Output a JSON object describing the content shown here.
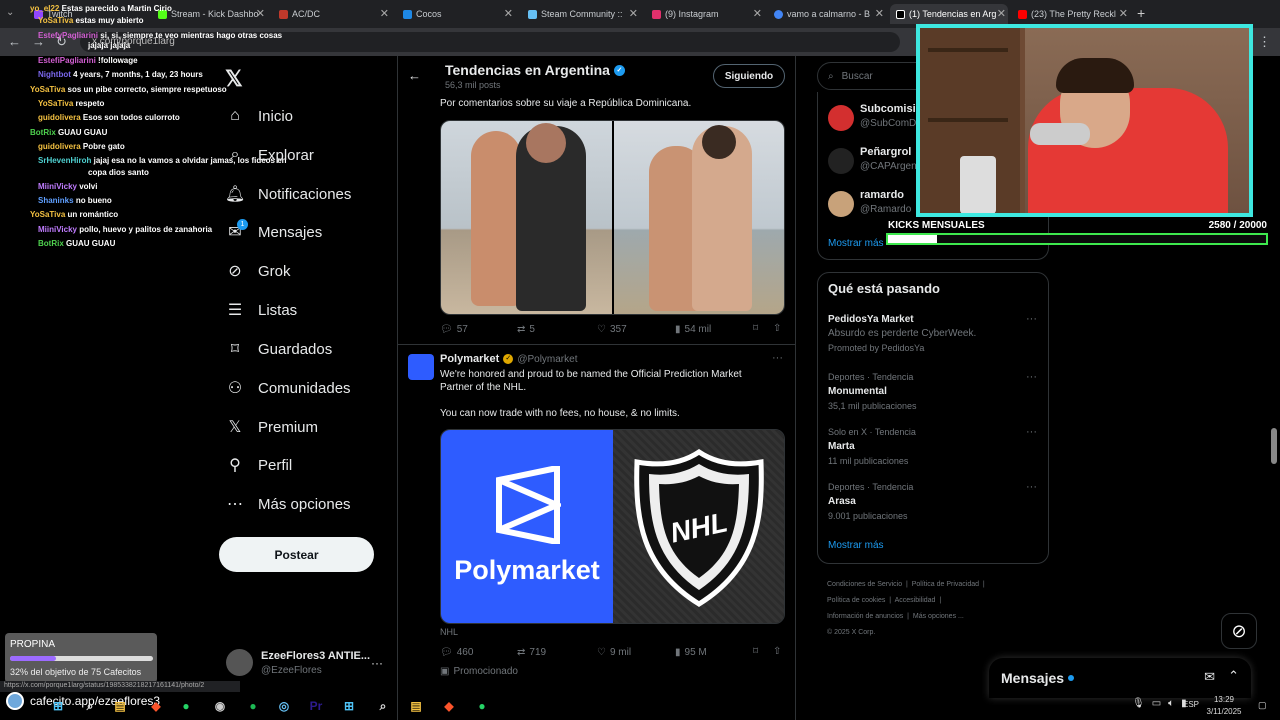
{
  "browser": {
    "tabs": [
      {
        "label": "Twitch",
        "color": "#9146ff"
      },
      {
        "label": "Stream - Kick Dashbo",
        "color": "#53fc18"
      },
      {
        "label": "AC/DC",
        "color": "#c0392b"
      },
      {
        "label": "Cocos",
        "color": "#1e88e5"
      },
      {
        "label": "Steam Community ::",
        "color": "#1b2838"
      },
      {
        "label": "(9) Instagram",
        "color": "#e1306c"
      },
      {
        "label": "vamo a calmarno - B",
        "color": "#4285f4"
      },
      {
        "label": "(1) Tendencias en Arg",
        "color": "#000000"
      },
      {
        "label": "(23) The Pretty Reckl",
        "color": "#ff0000"
      }
    ],
    "url": "x.com/porque1larg",
    "status_url": "https://x.com/porque1larg/status/1985338218217161141/photo/2"
  },
  "chat": [
    {
      "user": "yo_el22",
      "msg": "Estas parecido a Martin Cirio",
      "color": "#f5c242"
    },
    {
      "user": "YoSaTiva",
      "msg": "estas muy abierto",
      "color": "#f5c242"
    },
    {
      "user": "EstefyPagliarini",
      "msg": "si, si, siempre te veo mientras hago otras cosas",
      "color": "#d25fd2"
    },
    {
      "user": "",
      "msg": "jajaja jajaja",
      "color": "#ffffff"
    },
    {
      "user": "EstefiPagliarini",
      "msg": "!followage",
      "color": "#d25fd2"
    },
    {
      "user": "Nightbot",
      "msg": "4 years, 7 months, 1 day, 23 hours",
      "color": "#7b68ee"
    },
    {
      "user": "YoSaTiva",
      "msg": "sos un pibe correcto, siempre respetuoso",
      "color": "#f5c242"
    },
    {
      "user": "YoSaTiva",
      "msg": "respeto",
      "color": "#f5c242"
    },
    {
      "user": "guidolivera",
      "msg": "Esos son todos culorroto",
      "color": "#f5c242"
    },
    {
      "user": "BotRix",
      "msg": "GUAU GUAU",
      "color": "#4fd14f"
    },
    {
      "user": "guidolivera",
      "msg": "Pobre gato",
      "color": "#f5c242"
    },
    {
      "user": "SrHevenHiroh",
      "msg": "jajaj esa no la vamos a olvidar jamas, los fideos en",
      "color": "#4fd1d1"
    },
    {
      "user": "",
      "msg": "copa dios santo",
      "color": "#ffffff"
    },
    {
      "user": "MiiniVicky",
      "msg": "volvi",
      "color": "#c07cff"
    },
    {
      "user": "Shaninks",
      "msg": "no bueno",
      "color": "#5f9fff"
    },
    {
      "user": "YoSaTiva",
      "msg": "un romántico",
      "color": "#f5c242"
    },
    {
      "user": "MiiniVicky",
      "msg": "pollo, huevo y palitos de zanahoria",
      "color": "#c07cff"
    },
    {
      "user": "BotRix",
      "msg": "GUAU GUAU",
      "color": "#4fd14f"
    }
  ],
  "nav": {
    "items": [
      {
        "label": "Inicio",
        "icon": "home-icon"
      },
      {
        "label": "Explorar",
        "icon": "search-icon"
      },
      {
        "label": "Notificaciones",
        "icon": "bell-icon"
      },
      {
        "label": "Mensajes",
        "icon": "mail-icon",
        "badge": "1"
      },
      {
        "label": "Grok",
        "icon": "grok-icon"
      },
      {
        "label": "Listas",
        "icon": "list-icon"
      },
      {
        "label": "Guardados",
        "icon": "bookmark-icon"
      },
      {
        "label": "Comunidades",
        "icon": "people-icon"
      },
      {
        "label": "Premium",
        "icon": "x-icon"
      },
      {
        "label": "Perfil",
        "icon": "person-icon"
      },
      {
        "label": "Más opciones",
        "icon": "more-icon"
      }
    ],
    "post_button": "Postear",
    "account_name": "EzeeFlores3 ANTIE...",
    "account_handle": "@EzeeFlores"
  },
  "header": {
    "title": "Tendencias en Argentina",
    "subtitle": "56,3 mil posts",
    "follow_button": "Siguiendo"
  },
  "tweet1": {
    "text": "Por comentarios sobre su viaje a República Dominicana.",
    "replies": "57",
    "retweets": "5",
    "likes": "357",
    "views": "54 mil"
  },
  "tweet2": {
    "name": "Polymarket",
    "handle": "@Polymarket",
    "text1": "We're honored and proud to be named the Official Prediction Market",
    "text2": "Partner of the NHL.",
    "text3": "You can now trade with no fees, no house, & no limits.",
    "brand": "Polymarket",
    "card_caption": "NHL",
    "replies": "460",
    "retweets": "719",
    "likes": "9 mil",
    "views": "95 M",
    "promoted": "Promocionado",
    "brand_color": "#2e5cff"
  },
  "search": {
    "placeholder": "Buscar"
  },
  "follow_suggestions": [
    {
      "name": "Subcomisió",
      "handle": "@SubComD"
    },
    {
      "name": "Peñargrol",
      "handle": "@CAPArgen"
    },
    {
      "name": "ramardo",
      "handle": "@Ramardo"
    }
  ],
  "show_more": "Mostrar más",
  "whats_happening": {
    "title": "Qué está pasando",
    "items": [
      {
        "category": "",
        "name": "PedidosYa Market",
        "desc": "Absurdo es perderte CyberWeek.",
        "count": "Promoted by PedidosYa"
      },
      {
        "category": "Deportes · Tendencia",
        "name": "Monumental",
        "desc": "",
        "count": "35,1 mil publicaciones"
      },
      {
        "category": "Solo en X · Tendencia",
        "name": "Marta",
        "desc": "",
        "count": "11 mil publicaciones"
      },
      {
        "category": "Deportes · Tendencia",
        "name": "Arasa",
        "desc": "",
        "count": "9.001 publicaciones"
      }
    ],
    "show_more": "Mostrar más"
  },
  "footer": {
    "links1": [
      "Condiciones de Servicio",
      "Política de Privacidad"
    ],
    "links2": [
      "Política de cookies",
      "Accesibilidad"
    ],
    "links3": [
      "Información de anuncios",
      "Más opciones ..."
    ],
    "copyright": "© 2025 X Corp."
  },
  "messages_drawer": {
    "title": "Mensajes"
  },
  "stream": {
    "kicks_label": "KICKS MENSUALES",
    "kicks_value": "2580  / 20000",
    "kicks_progress": 0.129,
    "tip_title": "PROPINA",
    "tip_progress_text": "32% del objetivo de 75 Cafecitos",
    "tip_progress": 0.32,
    "tip_url": "cafecito.app/ezeeflores3"
  },
  "taskbar": {
    "time": "13:29",
    "date": "3/11/2025",
    "lang": "ESP"
  }
}
